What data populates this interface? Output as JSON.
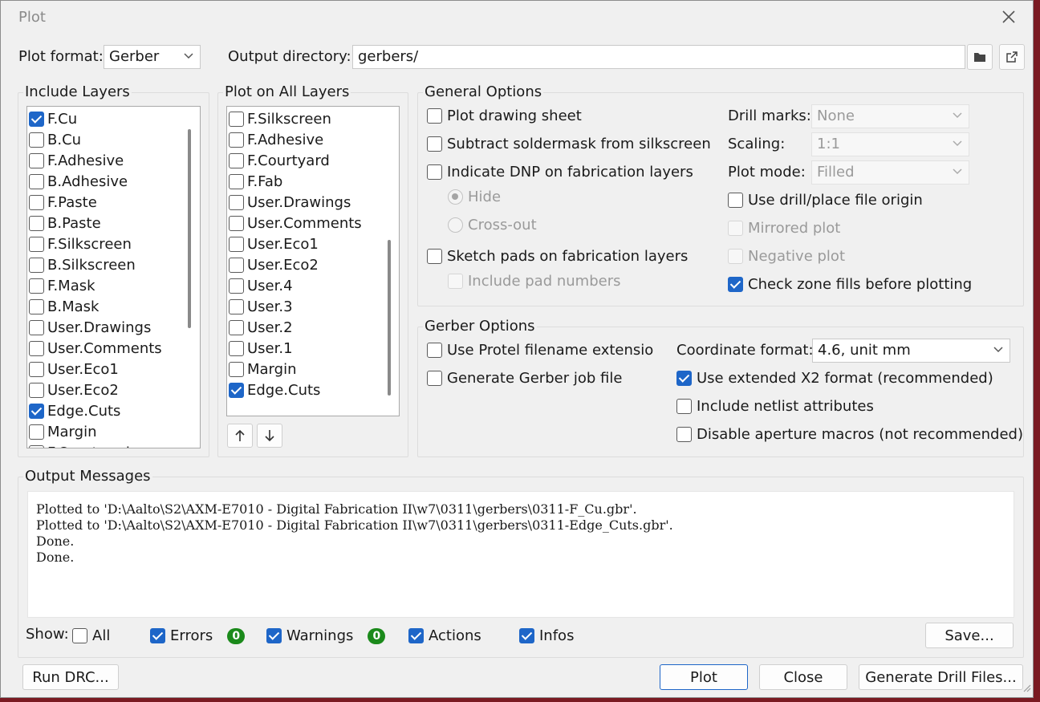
{
  "window": {
    "title": "Plot"
  },
  "top": {
    "plot_format_label": "Plot format:",
    "plot_format_value": "Gerber",
    "output_dir_label": "Output directory:",
    "output_dir_value": "gerbers/"
  },
  "include_layers": {
    "title": "Include Layers",
    "items": [
      {
        "label": "F.Cu",
        "checked": true
      },
      {
        "label": "B.Cu",
        "checked": false
      },
      {
        "label": "F.Adhesive",
        "checked": false
      },
      {
        "label": "B.Adhesive",
        "checked": false
      },
      {
        "label": "F.Paste",
        "checked": false
      },
      {
        "label": "B.Paste",
        "checked": false
      },
      {
        "label": "F.Silkscreen",
        "checked": false
      },
      {
        "label": "B.Silkscreen",
        "checked": false
      },
      {
        "label": "F.Mask",
        "checked": false
      },
      {
        "label": "B.Mask",
        "checked": false
      },
      {
        "label": "User.Drawings",
        "checked": false
      },
      {
        "label": "User.Comments",
        "checked": false
      },
      {
        "label": "User.Eco1",
        "checked": false
      },
      {
        "label": "User.Eco2",
        "checked": false
      },
      {
        "label": "Edge.Cuts",
        "checked": true
      },
      {
        "label": "Margin",
        "checked": false
      },
      {
        "label": "F.Courtyard",
        "checked": false
      }
    ]
  },
  "plot_all_layers": {
    "title": "Plot on All Layers",
    "items": [
      {
        "label": "F.Silkscreen",
        "checked": false
      },
      {
        "label": "F.Adhesive",
        "checked": false
      },
      {
        "label": "F.Courtyard",
        "checked": false
      },
      {
        "label": "F.Fab",
        "checked": false
      },
      {
        "label": "User.Drawings",
        "checked": false
      },
      {
        "label": "User.Comments",
        "checked": false
      },
      {
        "label": "User.Eco1",
        "checked": false
      },
      {
        "label": "User.Eco2",
        "checked": false
      },
      {
        "label": "User.4",
        "checked": false
      },
      {
        "label": "User.3",
        "checked": false
      },
      {
        "label": "User.2",
        "checked": false
      },
      {
        "label": "User.1",
        "checked": false
      },
      {
        "label": "Margin",
        "checked": false
      },
      {
        "label": "Edge.Cuts",
        "checked": true
      }
    ]
  },
  "general": {
    "title": "General Options",
    "plot_drawing_sheet": "Plot drawing sheet",
    "subtract_soldermask": "Subtract soldermask from silkscreen",
    "indicate_dnp": "Indicate DNP on fabrication layers",
    "hide": "Hide",
    "cross_out": "Cross-out",
    "sketch_pads": "Sketch pads on fabrication layers",
    "include_pad_numbers": "Include pad numbers",
    "drill_marks_label": "Drill marks:",
    "drill_marks_value": "None",
    "scaling_label": "Scaling:",
    "scaling_value": "1:1",
    "plot_mode_label": "Plot mode:",
    "plot_mode_value": "Filled",
    "use_drill_origin": "Use drill/place file origin",
    "mirrored_plot": "Mirrored plot",
    "negative_plot": "Negative plot",
    "check_zone_fills": "Check zone fills before plotting"
  },
  "gerber": {
    "title": "Gerber Options",
    "use_protel": "Use Protel filename extensions",
    "generate_job": "Generate Gerber job file",
    "coord_label": "Coordinate format:",
    "coord_value": "4.6, unit mm",
    "use_x2": "Use extended X2 format (recommended)",
    "include_netlist": "Include netlist attributes",
    "disable_aperture": "Disable aperture macros (not recommended)"
  },
  "messages": {
    "title": "Output Messages",
    "text": "Plotted to 'D:\\Aalto\\S2\\AXM-E7010 - Digital Fabrication II\\w7\\0311\\gerbers\\0311-F_Cu.gbr'.\nPlotted to 'D:\\Aalto\\S2\\AXM-E7010 - Digital Fabrication II\\w7\\0311\\gerbers\\0311-Edge_Cuts.gbr'.\nDone.\nDone.",
    "show_label": "Show:",
    "all": "All",
    "errors": "Errors",
    "errors_count": "0",
    "warnings": "Warnings",
    "warnings_count": "0",
    "actions": "Actions",
    "infos": "Infos",
    "save": "Save..."
  },
  "footer": {
    "run_drc": "Run DRC...",
    "plot": "Plot",
    "close": "Close",
    "generate_drill": "Generate Drill Files..."
  },
  "colors": {
    "accent": "#1e66c8",
    "badge": "#1b8a1b",
    "background": "#7a1a22"
  }
}
